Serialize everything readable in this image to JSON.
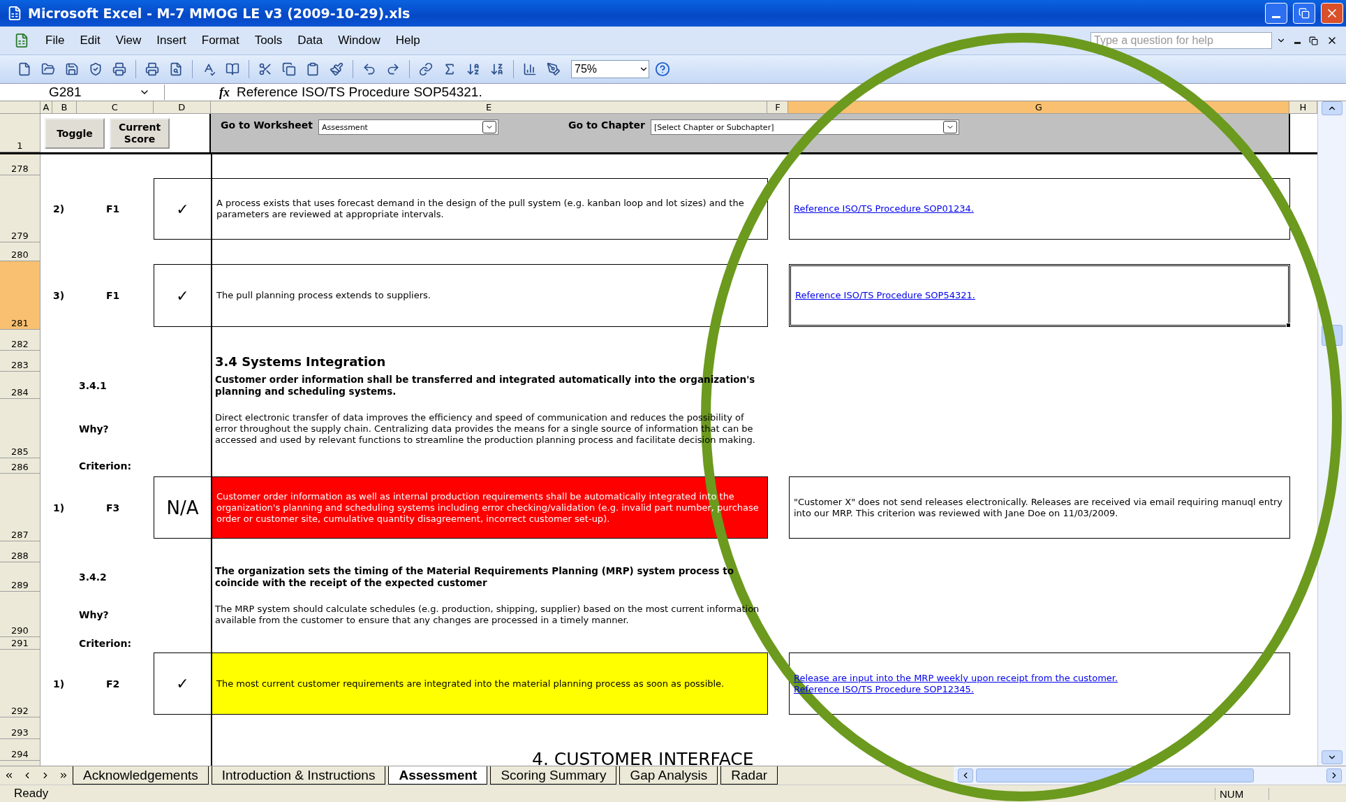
{
  "window": {
    "title": "Microsoft Excel - M-7 MMOG LE v3 (2009-10-29).xls"
  },
  "menu": [
    "File",
    "Edit",
    "View",
    "Insert",
    "Format",
    "Tools",
    "Data",
    "Window",
    "Help"
  ],
  "help_search": {
    "placeholder": "Type a question for help"
  },
  "zoom": "75%",
  "name_box": "G281",
  "function_label": "fx",
  "formula": "Reference ISO/TS Procedure SOP54321.",
  "columns": [
    {
      "label": "A",
      "selected": false
    },
    {
      "label": "B",
      "selected": false
    },
    {
      "label": "C",
      "selected": false
    },
    {
      "label": "D",
      "selected": false
    },
    {
      "label": "E",
      "selected": false
    },
    {
      "label": "F",
      "selected": false
    },
    {
      "label": "G",
      "selected": true
    },
    {
      "label": "H",
      "selected": false
    }
  ],
  "header_row": {
    "number": "1",
    "buttons": [
      "Toggle",
      "Current Score"
    ],
    "worksheet_label": "Go to Worksheet",
    "worksheet_value": "Assessment",
    "chapter_label": "Go to Chapter",
    "chapter_value": "[Select Chapter or Subchapter]"
  },
  "rows": [
    {
      "number": "278",
      "selected": false
    },
    {
      "number": "279",
      "selected": false
    },
    {
      "number": "280",
      "selected": false
    },
    {
      "number": "281",
      "selected": true
    },
    {
      "number": "282",
      "selected": false
    },
    {
      "number": "283",
      "selected": false
    },
    {
      "number": "284",
      "selected": false
    },
    {
      "number": "285",
      "selected": false
    },
    {
      "number": "286",
      "selected": false
    },
    {
      "number": "287",
      "selected": false
    },
    {
      "number": "288",
      "selected": false
    },
    {
      "number": "289",
      "selected": false
    },
    {
      "number": "290",
      "selected": false
    },
    {
      "number": "291",
      "selected": false
    },
    {
      "number": "292",
      "selected": false
    },
    {
      "number": "293",
      "selected": false
    },
    {
      "number": "294",
      "selected": false
    }
  ],
  "blocks": [
    {
      "kind": "criterion",
      "number": "2)",
      "code": "F1",
      "score": {
        "kind": "mark",
        "text": "✓"
      },
      "color": "#ffffff",
      "text": "A process exists that uses forecast demand in the design of the pull system (e.g. kanban loop and lot sizes) and the parameters are reviewed at appropriate intervals.",
      "comment": {
        "kind": "link",
        "lines": [
          "Reference ISO/TS Procedure SOP01234."
        ]
      },
      "selected": false
    },
    {
      "kind": "criterion",
      "number": "3)",
      "code": "F1",
      "score": {
        "kind": "mark",
        "text": "✓"
      },
      "color": "#ffffff",
      "text": "The pull planning process extends to suppliers.",
      "comment": {
        "kind": "link",
        "lines": [
          "Reference ISO/TS Procedure SOP54321."
        ]
      },
      "selected": true
    },
    {
      "kind": "heading",
      "text": "3.4 Systems Integration"
    },
    {
      "kind": "requirement",
      "id": "3.4.1",
      "title": "Customer order information shall be transferred and integrated automatically into the organization's planning and scheduling systems.",
      "why_label": "Why?",
      "why": "Direct electronic transfer of data improves the efficiency and speed of communication and reduces the possibility of error throughout the supply chain.  Centralizing data provides the means for a single source of information that can be accessed and used by relevant functions to streamline the production planning process and facilitate decision making.",
      "criterion_label": "Criterion:"
    },
    {
      "kind": "criterion",
      "number": "1)",
      "code": "F3",
      "score": {
        "kind": "word",
        "text": "N/A"
      },
      "color": "#ff0000",
      "text": "Customer order information as well as internal production requirements shall be automatically integrated into the organization's planning and scheduling systems including error checking/validation (e.g. invalid part number, purchase order or customer site, cumulative quantity disagreement, incorrect customer set-up).",
      "comment": {
        "kind": "note",
        "lines": [
          "\"Customer X\" does not send releases electronically.  Releases are received via email requiring manuql entry into our MRP.  This criterion was reviewed with Jane Doe on 11/03/2009."
        ]
      },
      "selected": false
    },
    {
      "kind": "requirement",
      "id": "3.4.2",
      "title": "The organization sets the timing of the Material Requirements Planning (MRP) system process to coincide with the receipt of the expected customer",
      "why_label": "Why?",
      "why": "The MRP system should calculate schedules (e.g. production, shipping, supplier) based on the most current information available from the customer to ensure that any changes are processed in a timely manner.",
      "criterion_label": "Criterion:"
    },
    {
      "kind": "criterion",
      "number": "1)",
      "code": "F2",
      "score": {
        "kind": "mark",
        "text": "✓"
      },
      "color": "#ffff00",
      "text": "The most current customer requirements are integrated into the material planning process as soon as possible.",
      "comment": {
        "kind": "link",
        "lines": [
          "Release are input into the MRP weekly upon receipt from the customer.",
          "Reference ISO/TS Procedure SOP12345."
        ]
      },
      "selected": false
    },
    {
      "kind": "chapter",
      "text": "4. CUSTOMER INTERFACE"
    }
  ],
  "sheet_tabs": [
    {
      "label": "Acknowledgements",
      "selected": false
    },
    {
      "label": "Introduction & Instructions",
      "selected": false
    },
    {
      "label": "Assessment",
      "selected": true
    },
    {
      "label": "Scoring Summary",
      "selected": false
    },
    {
      "label": "Gap Analysis",
      "selected": false
    },
    {
      "label": "Radar",
      "selected": false
    }
  ],
  "status_bar": {
    "text": "Ready",
    "indicator": "NUM"
  }
}
